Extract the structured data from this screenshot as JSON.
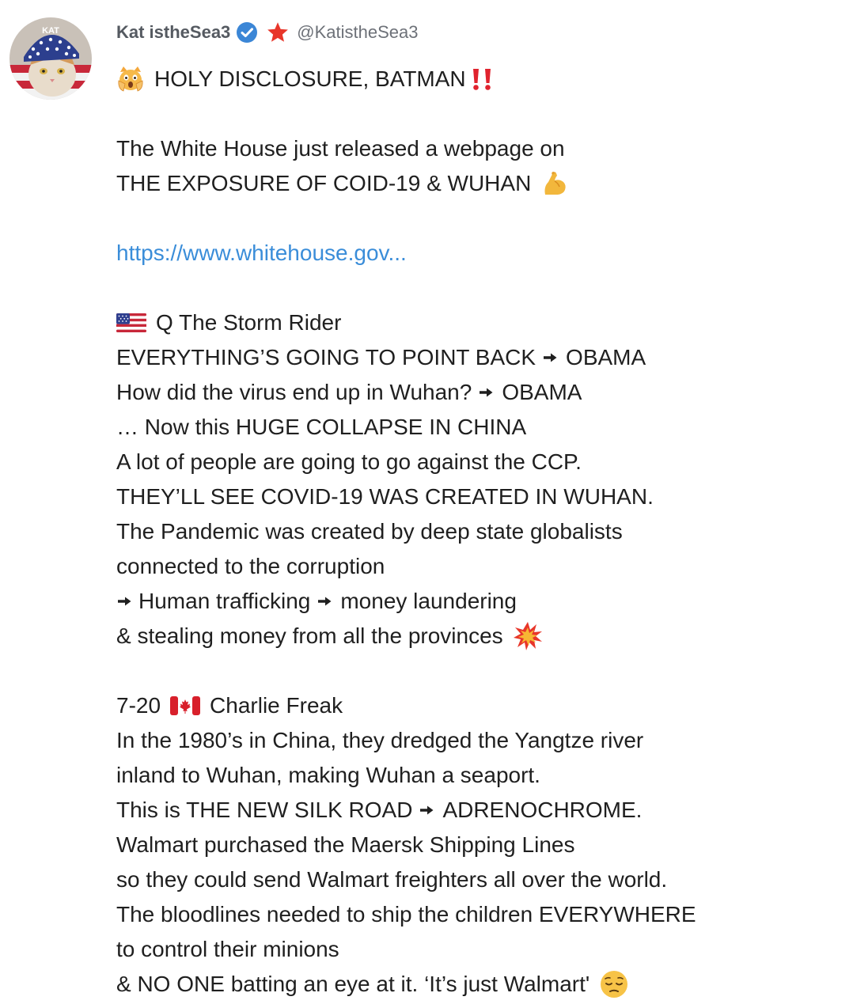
{
  "post": {
    "author": {
      "display_name": "Kat istheSea3",
      "handle": "@KatistheSea3",
      "verified": true,
      "avatar_text": "KAT"
    },
    "lines": {
      "headline": "HOLY DISCLOSURE, BATMAN",
      "wh_1": "The White House just released a webpage on",
      "wh_2": "THE EXPOSURE OF COID-19 & WUHAN",
      "link": "https://www.whitehouse.gov...",
      "q_header": "Q The Storm Rider",
      "q_1a": "EVERYTHING’S GOING TO POINT BACK",
      "q_1b": "OBAMA",
      "q_2a": "How did the virus end up in Wuhan?",
      "q_2b": "OBAMA",
      "q_3": "… Now this HUGE COLLAPSE IN CHINA",
      "q_4": "A lot of people are going to go against the CCP.",
      "q_5": "THEY’LL SEE COVID-19 WAS CREATED IN WUHAN.",
      "q_6": "The Pandemic was created by deep state globalists",
      "q_7": "connected to the corruption",
      "q_8a": "Human trafficking",
      "q_8b": "money laundering",
      "q_9": "& stealing money from all the provinces",
      "cf_date": "7-20",
      "cf_name": "Charlie Freak",
      "cf_1": "In the 1980’s in China, they dredged the Yangtze river",
      "cf_2": "inland to Wuhan, making Wuhan a seaport.",
      "cf_3a": "This is THE NEW SILK ROAD",
      "cf_3b": "ADRENOCHROME.",
      "cf_4": "Walmart purchased the Maersk Shipping Lines",
      "cf_5": "so they could send Walmart freighters all over the world.",
      "cf_6": "The bloodlines needed to ship the children EVERYWHERE",
      "cf_7": "to control their minions",
      "cf_8": "& NO ONE batting an eye at it. ‘It’s just Walmart'"
    },
    "icons": {
      "verified": "verified-badge-icon",
      "star": "star-icon",
      "headline_emoji": "scream-cat-emoji",
      "double_exclamation": "double-exclamation-emoji",
      "muscle": "flexed-biceps-emoji",
      "us_flag": "us-flag-emoji",
      "arrow": "right-arrow-emoji",
      "collision": "collision-emoji",
      "canada_flag": "canada-flag-emoji",
      "pensive": "pensive-face-emoji"
    },
    "colors": {
      "link": "#3a8dd9",
      "verified": "#3b86d6",
      "star": "#e8362a",
      "name": "#555a61",
      "handle": "#6d7178",
      "text": "#1f1f1f"
    }
  }
}
